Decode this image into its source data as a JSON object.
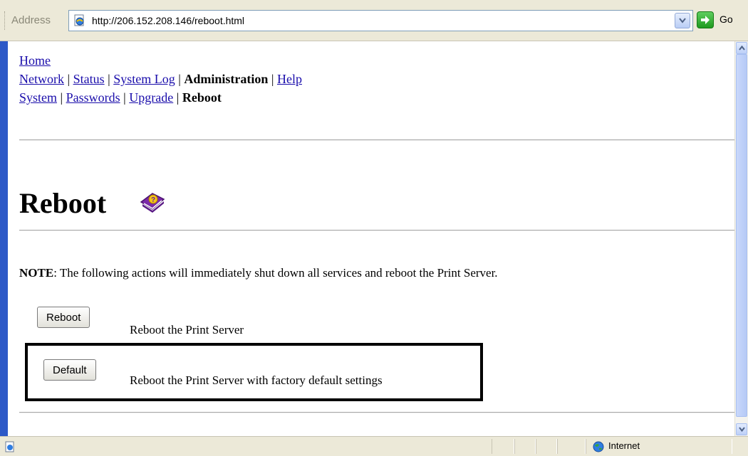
{
  "address_bar": {
    "label": "Address",
    "url": "http://206.152.208.146/reboot.html",
    "go_label": "Go"
  },
  "nav": {
    "home": "Home",
    "main": [
      {
        "label": "Network",
        "link": true
      },
      {
        "label": "Status",
        "link": true
      },
      {
        "label": "System Log",
        "link": true
      },
      {
        "label": "Administration",
        "link": false
      },
      {
        "label": "Help",
        "link": true
      }
    ],
    "sub": [
      {
        "label": "System",
        "link": true
      },
      {
        "label": "Passwords",
        "link": true
      },
      {
        "label": "Upgrade",
        "link": true
      },
      {
        "label": "Reboot",
        "link": false
      }
    ],
    "separator": "|"
  },
  "page": {
    "title": "Reboot",
    "note_label": "NOTE",
    "note_text": ": The following actions will immediately shut down all services and reboot the Print Server."
  },
  "actions": [
    {
      "button": "Reboot",
      "description": "Reboot the Print Server"
    },
    {
      "button": "Default",
      "description": "Reboot the Print Server with factory default settings"
    }
  ],
  "status_bar": {
    "zone": "Internet"
  },
  "colors": {
    "link": "#1a0dab",
    "window_frame": "#2d59c7",
    "chrome": "#ece9d8",
    "highlight_border": "#000000"
  },
  "icons": {
    "page": "ie-page-icon",
    "dropdown": "chevron-down-icon",
    "go": "go-arrow-icon",
    "help": "help-book-icon",
    "zone": "globe-icon"
  }
}
